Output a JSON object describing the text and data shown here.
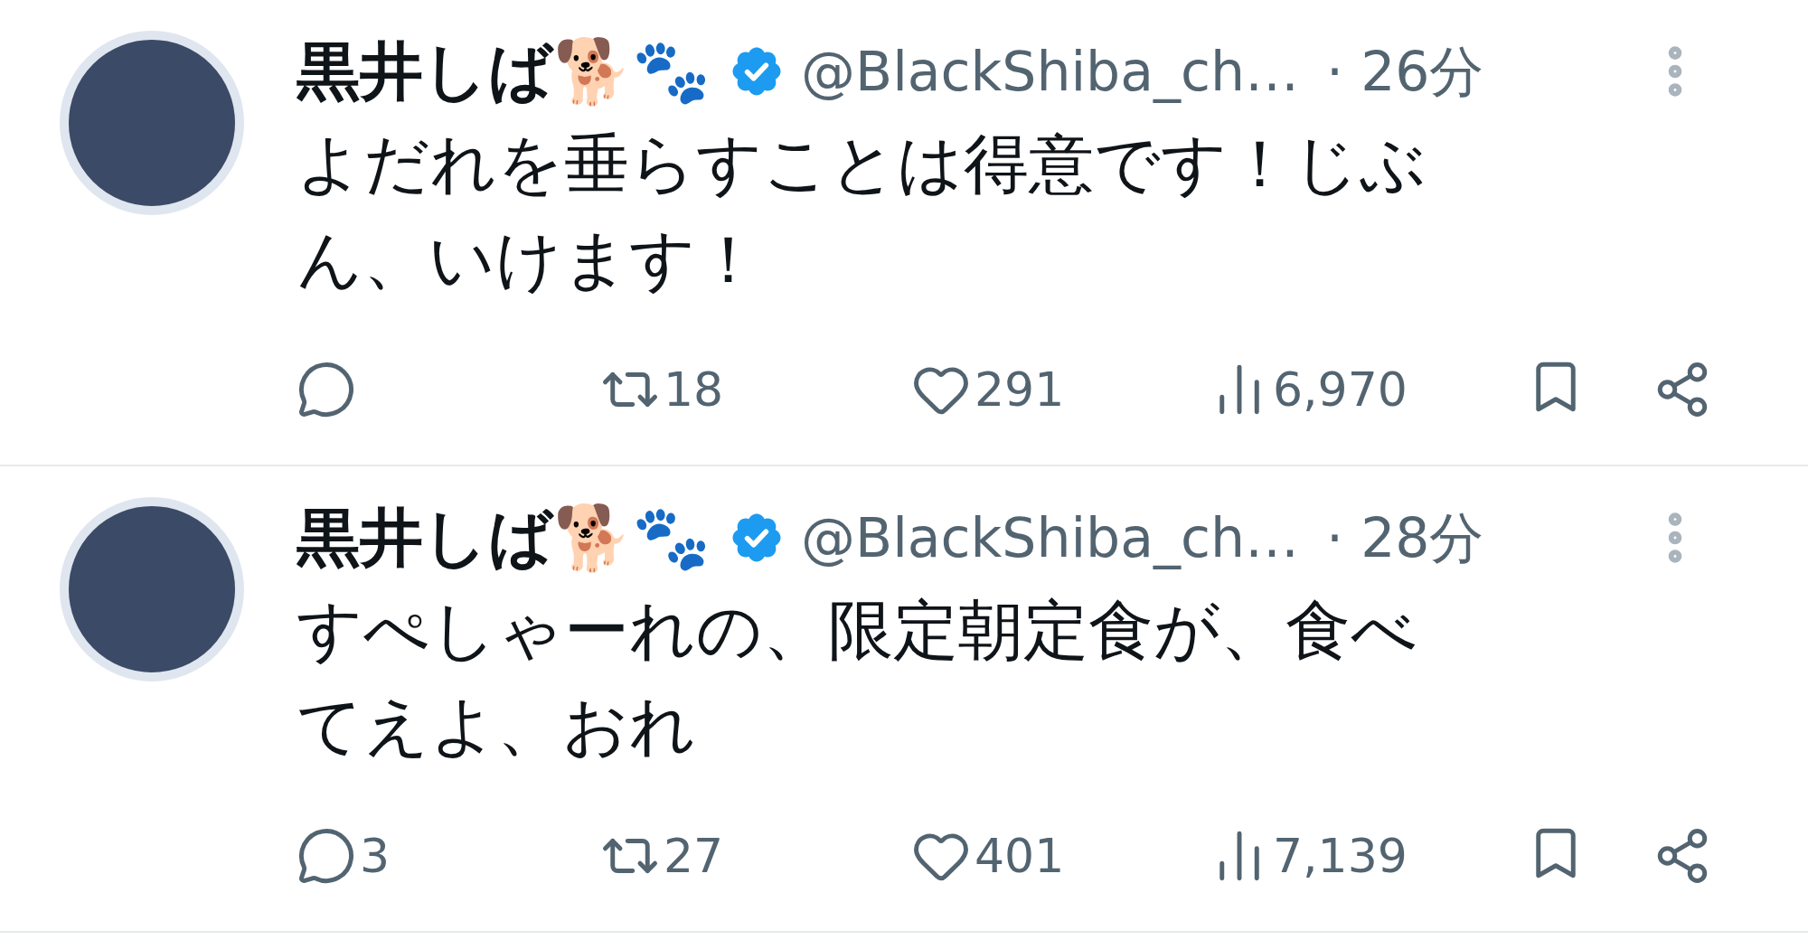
{
  "tweets": [
    {
      "name": "黒井しば🐕🐾",
      "handle": "@BlackShiba_ch…",
      "time": "· 26分",
      "text": "よだれを垂らすことは得意です！じぶん、いけます！",
      "retweets": "18",
      "likes": "291",
      "views": "6,970"
    },
    {
      "name": "黒井しば🐕🐾",
      "handle": "@BlackShiba_ch…",
      "time": "· 28分",
      "text": "すぺしゃーれの、限定朝定食が、食べてえよ、おれ",
      "replies": "3",
      "retweets": "27",
      "likes": "401",
      "views": "7,139"
    }
  ]
}
